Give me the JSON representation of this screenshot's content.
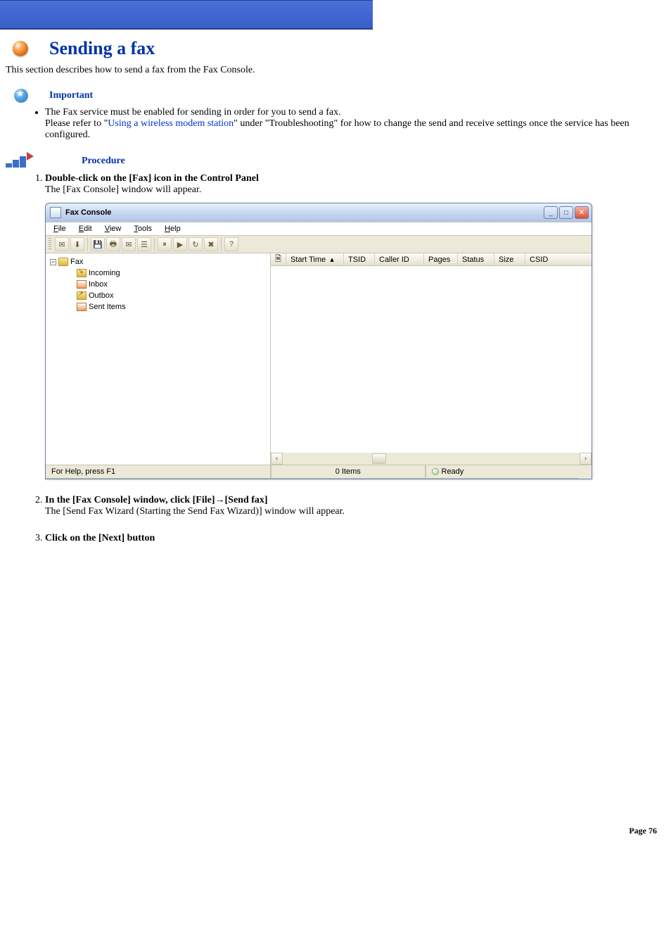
{
  "page": {
    "title": "Sending a fax",
    "intro": "This section describes how to send a fax from the Fax Console.",
    "footer_label": "Page",
    "footer_number": "76"
  },
  "important": {
    "heading": "Important",
    "bullet_pre": "The Fax service must be enabled for sending in order for you to send a fax.",
    "bullet_line2a": "Please refer to \"",
    "bullet_link": "Using a wireless modem station",
    "bullet_line2b": "\" under \"Troubleshooting\" for how to change the send and receive settings once the service has been configured."
  },
  "procedure": {
    "heading": "Procedure",
    "steps": [
      {
        "title": "Double-click on the [Fax] icon in the Control Panel",
        "desc": "The [Fax Console] window will appear."
      },
      {
        "title": "In the [Fax Console] window, click [File]→[Send fax]",
        "desc": "The [Send Fax Wizard (Starting the Send Fax Wizard)] window will appear."
      },
      {
        "title": "Click on the [Next] button",
        "desc": ""
      }
    ]
  },
  "fax_window": {
    "title": "Fax Console",
    "menu": {
      "file": "File",
      "edit": "Edit",
      "view": "View",
      "tools": "Tools",
      "help": "Help"
    },
    "tree": {
      "root": "Fax",
      "items": [
        "Incoming",
        "Inbox",
        "Outbox",
        "Sent Items"
      ]
    },
    "columns": {
      "icon": "🗎",
      "start_time": "Start Time",
      "sort": "▴",
      "tsid": "TSID",
      "caller_id": "Caller ID",
      "pages": "Pages",
      "status": "Status",
      "size": "Size",
      "csid": "CSID"
    },
    "status": {
      "help": "For Help, press F1",
      "items": "0 Items",
      "ready": "Ready"
    }
  }
}
